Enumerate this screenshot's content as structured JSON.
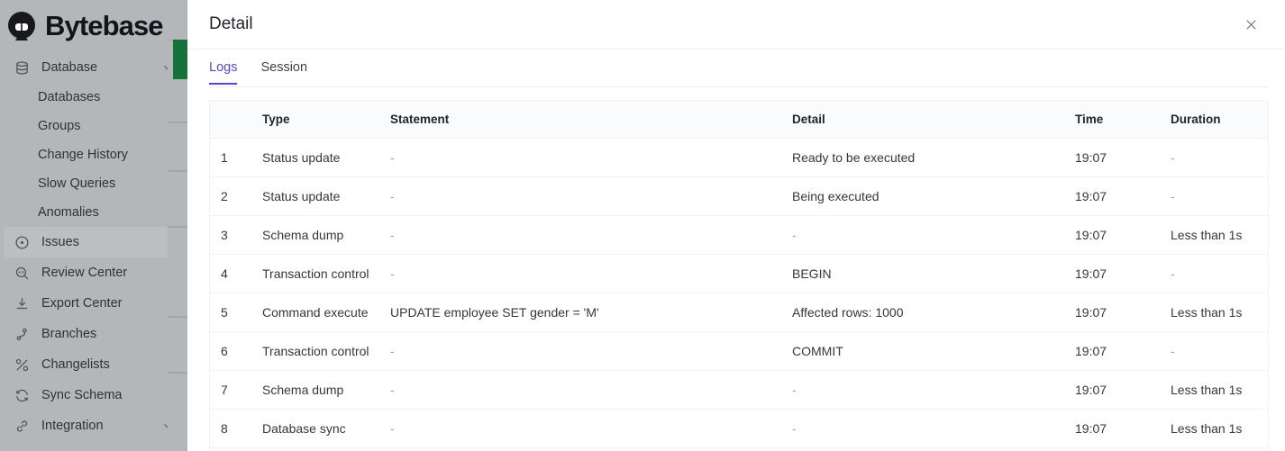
{
  "app": {
    "brand_name": "Bytebase",
    "brand_icon": "bytebase-logo-icon"
  },
  "sidebar": {
    "items": [
      {
        "label": "Database",
        "icon": "database-icon",
        "type": "group",
        "expanded": true,
        "chevron": "chevron-down-icon"
      },
      {
        "label": "Databases",
        "type": "sub"
      },
      {
        "label": "Groups",
        "type": "sub"
      },
      {
        "label": "Change History",
        "type": "sub"
      },
      {
        "label": "Slow Queries",
        "type": "sub"
      },
      {
        "label": "Anomalies",
        "type": "sub"
      },
      {
        "label": "Issues",
        "icon": "issues-icon",
        "type": "item",
        "active": true
      },
      {
        "label": "Review Center",
        "icon": "review-center-icon",
        "type": "item",
        "active": false
      },
      {
        "label": "Export Center",
        "icon": "export-center-icon",
        "type": "item",
        "active": false
      },
      {
        "label": "Branches",
        "icon": "branches-icon",
        "type": "item",
        "active": false
      },
      {
        "label": "Changelists",
        "icon": "changelists-icon",
        "type": "item",
        "active": false
      },
      {
        "label": "Sync Schema",
        "icon": "sync-schema-icon",
        "type": "item",
        "active": false
      },
      {
        "label": "Integration",
        "icon": "integration-icon",
        "type": "group",
        "expanded": false,
        "chevron": "chevron-down-icon"
      }
    ]
  },
  "modal": {
    "title": "Detail",
    "close_icon": "close-icon",
    "tabs": [
      {
        "label": "Logs",
        "active": true
      },
      {
        "label": "Session",
        "active": false
      }
    ],
    "table": {
      "columns": [
        "",
        "Type",
        "Statement",
        "Detail",
        "Time",
        "Duration"
      ],
      "rows": [
        {
          "index": "1",
          "type": "Status update",
          "statement": "-",
          "detail": "Ready to be executed",
          "time": "19:07",
          "duration": "-"
        },
        {
          "index": "2",
          "type": "Status update",
          "statement": "-",
          "detail": "Being executed",
          "time": "19:07",
          "duration": "-"
        },
        {
          "index": "3",
          "type": "Schema dump",
          "statement": "-",
          "detail": "-",
          "time": "19:07",
          "duration": "Less than 1s"
        },
        {
          "index": "4",
          "type": "Transaction control",
          "statement": "-",
          "detail": "BEGIN",
          "time": "19:07",
          "duration": "-"
        },
        {
          "index": "5",
          "type": "Command execute",
          "statement": "UPDATE employee SET gender = 'M'",
          "detail": "Affected rows: 1000",
          "time": "19:07",
          "duration": "Less than 1s"
        },
        {
          "index": "6",
          "type": "Transaction control",
          "statement": "-",
          "detail": "COMMIT",
          "time": "19:07",
          "duration": "-"
        },
        {
          "index": "7",
          "type": "Schema dump",
          "statement": "-",
          "detail": "-",
          "time": "19:07",
          "duration": "Less than 1s"
        },
        {
          "index": "8",
          "type": "Database sync",
          "statement": "-",
          "detail": "-",
          "time": "19:07",
          "duration": "Less than 1s"
        }
      ]
    }
  },
  "colors": {
    "accent": "#4f46e5",
    "sidebar_bg": "#b4b7b9",
    "status_green": "#17713a",
    "table_header_bg": "#fafbfc"
  }
}
